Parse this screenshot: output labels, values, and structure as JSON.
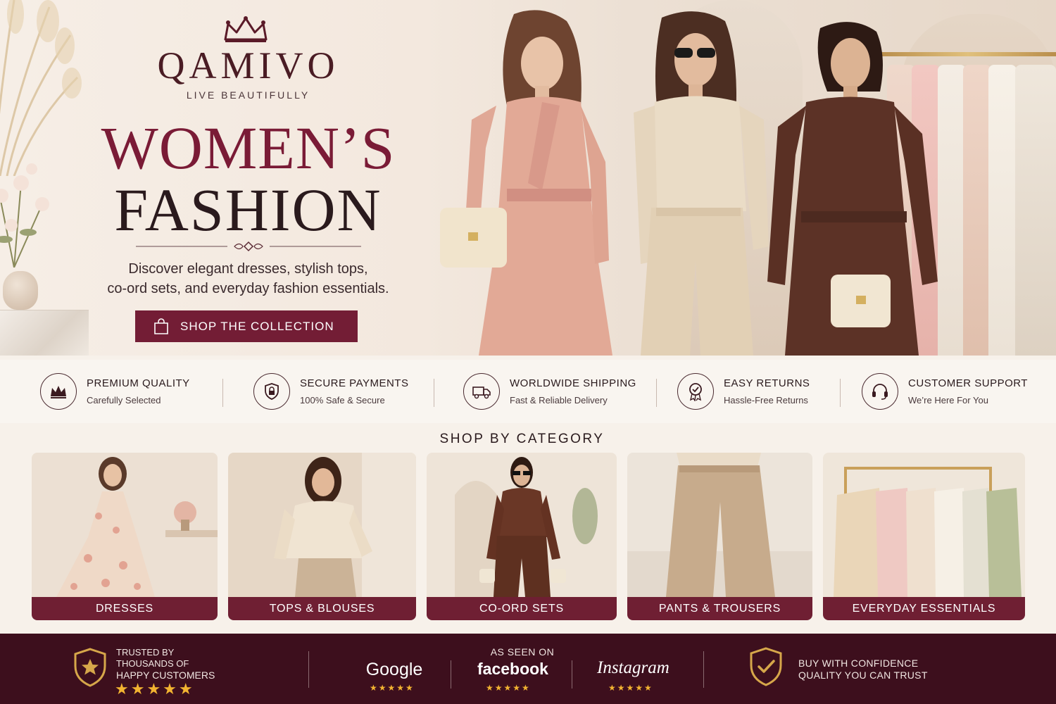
{
  "brand": {
    "name": "QAMIVO",
    "tagline": "LIVE BEAUTIFULLY"
  },
  "hero": {
    "headline_line1": "WOMEN’S",
    "headline_line2": "FASHION",
    "subtext_line1": "Discover elegant dresses, stylish tops,",
    "subtext_line2": "co-ord sets, and everyday fashion essentials.",
    "cta_label": "SHOP THE COLLECTION"
  },
  "features": [
    {
      "title": "PREMIUM QUALITY",
      "subtitle": "Carefully Selected",
      "icon": "crown-icon"
    },
    {
      "title": "SECURE PAYMENTS",
      "subtitle": "100% Safe & Secure",
      "icon": "shield-lock-icon"
    },
    {
      "title": "WORLDWIDE SHIPPING",
      "subtitle": "Fast & Reliable Delivery",
      "icon": "truck-icon"
    },
    {
      "title": "EASY RETURNS",
      "subtitle": "Hassle-Free Returns",
      "icon": "badge-check-icon"
    },
    {
      "title": "CUSTOMER SUPPORT",
      "subtitle": "We’re Here For You",
      "icon": "headset-icon"
    }
  ],
  "categories": {
    "title": "SHOP BY CATEGORY",
    "items": [
      {
        "label": "DRESSES"
      },
      {
        "label": "TOPS & BLOUSES"
      },
      {
        "label": "CO-ORD SETS"
      },
      {
        "label": "PANTS & TROUSERS"
      },
      {
        "label": "EVERYDAY ESSENTIALS"
      }
    ]
  },
  "trust": {
    "trusted_line1": "TRUSTED BY",
    "trusted_line2": "THOUSANDS OF",
    "trusted_line3": "HAPPY CUSTOMERS",
    "stars": "★★★★★",
    "as_seen_on": "AS SEEN ON",
    "logos": [
      {
        "name": "Google",
        "stars": "★★★★★"
      },
      {
        "name": "facebook",
        "stars": "★★★★★"
      },
      {
        "name": "Instagram",
        "stars": "★★★★★"
      }
    ],
    "confidence_line1": "BUY WITH CONFIDENCE",
    "confidence_line2": "QUALITY YOU CAN TRUST"
  },
  "colors": {
    "accent": "#731d35",
    "dark_band": "#3d0f1d",
    "star": "#f3b431",
    "background": "#f7f1ea"
  }
}
